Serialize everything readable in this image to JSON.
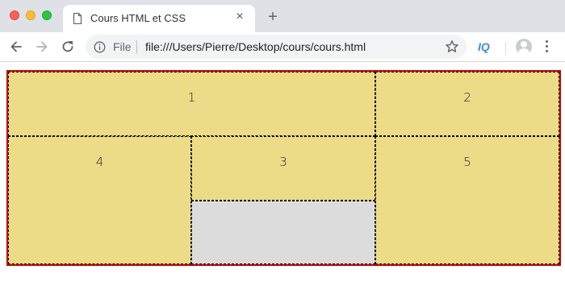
{
  "window": {
    "controls": [
      "close",
      "minimize",
      "maximize"
    ]
  },
  "tab": {
    "title": "Cours HTML et CSS",
    "close_label": "×",
    "icon": "document-icon"
  },
  "new_tab_label": "+",
  "toolbar": {
    "back_icon": "arrow-left-icon",
    "forward_icon": "arrow-right-icon",
    "reload_icon": "reload-icon",
    "scheme_label": "File",
    "url": "file:///Users/Pierre/Desktop/cours/cours.html",
    "extension_label": "IQ",
    "bookmark_icon": "star-icon",
    "menu_icon": "more-vertical-icon"
  },
  "grid": {
    "border_color": "#c80000",
    "cell_color": "#ecdb87",
    "empty_color": "#dcdcdc",
    "cells": [
      "1",
      "2",
      "3",
      "4",
      "5"
    ]
  }
}
